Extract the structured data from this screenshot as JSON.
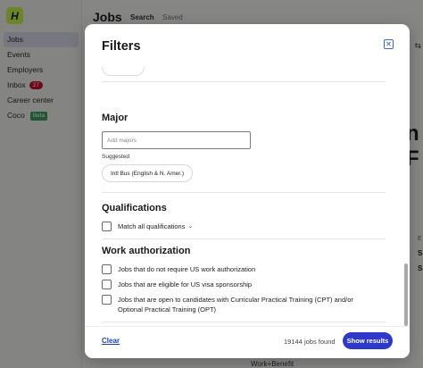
{
  "app": {
    "logo_letter": "H",
    "nav": [
      {
        "label": "Jobs",
        "active": true
      },
      {
        "label": "Events"
      },
      {
        "label": "Employers"
      },
      {
        "label": "Inbox",
        "count": "27"
      },
      {
        "label": "Career center"
      },
      {
        "label": "Coco",
        "badge": "Beta"
      }
    ],
    "page_title": "Jobs",
    "tabs": [
      "Search",
      "Saved"
    ],
    "peek": {
      "big": "n F",
      "e": "E",
      "s1": "S",
      "s2": "S",
      "bottom": "Work+Benefit"
    },
    "settings_icon": "⇆"
  },
  "filters": {
    "title": "Filters",
    "close_icon": "close-icon",
    "major": {
      "title": "Major",
      "placeholder": "Add majors",
      "suggested_label": "Suggested",
      "suggestions": [
        "Intl Bus (English & N. Amer.)"
      ]
    },
    "qualifications": {
      "title": "Qualifications",
      "match_all_label": "Match all qualifications"
    },
    "work_authorization": {
      "title": "Work authorization",
      "options": [
        "Jobs that do not require US work authorization",
        "Jobs that are eligible for US visa sponsorship",
        "Jobs that are open to candidates with Curricular Practical Training (CPT) and/or Optional Practical Training (OPT)"
      ]
    },
    "footer": {
      "clear_label": "Clear",
      "jobs_found": "19144 jobs found",
      "show_results_label": "Show results"
    }
  },
  "colors": {
    "accent": "#2f39c9",
    "logo": "#c8f04c",
    "inbox_badge": "#c8102e",
    "beta_badge": "#3a9d5d"
  }
}
